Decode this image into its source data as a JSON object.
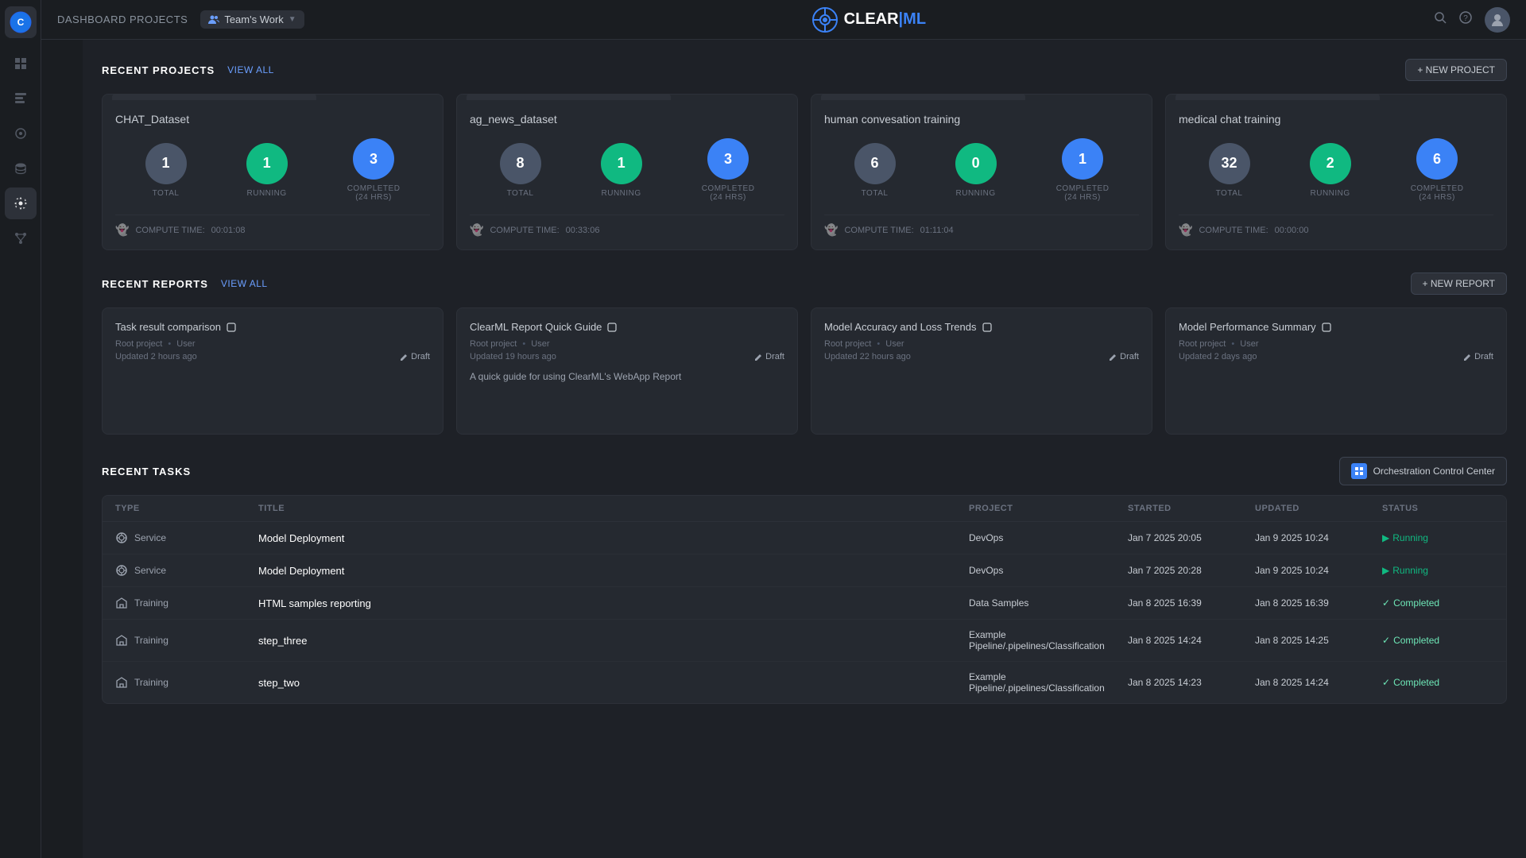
{
  "topbar": {
    "dashboard_title": "DASHBOARD PROJECTS",
    "team_label": "Team's Work",
    "logo_clear": "CLEAR",
    "logo_ml": "ML",
    "new_project_label": "+ NEW PROJECT",
    "new_report_label": "+ NEW REPORT"
  },
  "sections": {
    "recent_projects_title": "RECENT PROJECTS",
    "view_all_label": "VIEW ALL",
    "recent_reports_title": "RECENT REPORTS",
    "recent_tasks_title": "RECENT TASKS",
    "orchestration_btn": "Orchestration Control Center"
  },
  "projects": [
    {
      "name": "CHAT_Dataset",
      "total": "1",
      "running": "1",
      "completed": "3",
      "compute_label": "COMPUTE TIME:",
      "compute_time": "00:01:08"
    },
    {
      "name": "ag_news_dataset",
      "total": "8",
      "running": "1",
      "completed": "3",
      "compute_label": "COMPUTE TIME:",
      "compute_time": "00:33:06"
    },
    {
      "name": "human convesation training",
      "total": "6",
      "running": "0",
      "completed": "1",
      "compute_label": "COMPUTE TIME:",
      "compute_time": "01:11:04"
    },
    {
      "name": "medical chat training",
      "total": "32",
      "running": "2",
      "completed": "6",
      "compute_label": "COMPUTE TIME:",
      "compute_time": "00:00:00"
    }
  ],
  "stat_labels": {
    "total": "TOTAL",
    "running": "RUNNING",
    "completed_24": "COMPLETED\n(24 hrs)"
  },
  "reports": [
    {
      "title": "Task result comparison",
      "root_project": "Root project",
      "user": "User",
      "updated": "Updated 2 hours ago",
      "draft": "Draft",
      "description": ""
    },
    {
      "title": "ClearML Report Quick Guide",
      "root_project": "Root project",
      "user": "User",
      "updated": "Updated 19 hours ago",
      "draft": "Draft",
      "description": "A quick guide for using ClearML's WebApp Report"
    },
    {
      "title": "Model Accuracy and Loss Trends",
      "root_project": "Root project",
      "user": "User",
      "updated": "Updated 22 hours ago",
      "draft": "Draft",
      "description": ""
    },
    {
      "title": "Model Performance Summary",
      "root_project": "Root project",
      "user": "User",
      "updated": "Updated 2 days ago",
      "draft": "Draft",
      "description": ""
    }
  ],
  "table_headers": {
    "type": "TYPE",
    "title": "TITLE",
    "project": "PROJECT",
    "started": "STARTED",
    "updated": "UPDATED",
    "status": "STATUS"
  },
  "tasks": [
    {
      "type": "Service",
      "title": "Model Deployment",
      "project": "DevOps",
      "started": "Jan 7 2025 20:05",
      "updated": "Jan 9 2025 10:24",
      "status": "Running"
    },
    {
      "type": "Service",
      "title": "Model Deployment",
      "project": "DevOps",
      "started": "Jan 7 2025 20:28",
      "updated": "Jan 9 2025 10:24",
      "status": "Running"
    },
    {
      "type": "Training",
      "title": "HTML samples reporting",
      "project": "Data Samples",
      "started": "Jan 8 2025 16:39",
      "updated": "Jan 8 2025 16:39",
      "status": "Completed"
    },
    {
      "type": "Training",
      "title": "step_three",
      "project": "Example Pipeline/.pipelines/Classification",
      "started": "Jan 8 2025 14:24",
      "updated": "Jan 8 2025 14:25",
      "status": "Completed"
    },
    {
      "type": "Training",
      "title": "step_two",
      "project": "Example Pipeline/.pipelines/Classification",
      "started": "Jan 8 2025 14:23",
      "updated": "Jan 8 2025 14:24",
      "status": "Completed"
    }
  ]
}
